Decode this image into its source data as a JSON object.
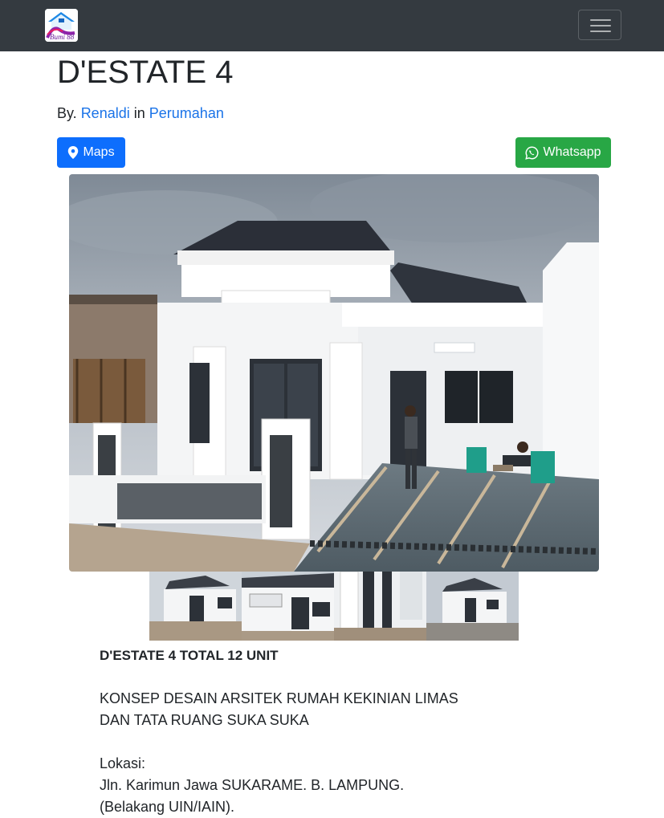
{
  "navbar": {
    "logo_text": "Bumi 88",
    "menu_icon": "hamburger-menu-icon"
  },
  "post": {
    "title": "D'ESTATE 4",
    "byline_prefix": "By.",
    "author": "Renaldi",
    "byline_in": "in",
    "category": "Perumahan"
  },
  "actions": {
    "maps_label": "Maps",
    "maps_icon": "map-marker-icon",
    "whatsapp_label": "Whatsapp",
    "whatsapp_icon": "whatsapp-icon"
  },
  "gallery": {
    "main_image": "house-photo",
    "thumbnails": [
      "thumb-1",
      "thumb-2",
      "thumb-3",
      "thumb-4"
    ]
  },
  "description": {
    "heading": "D'ESTATE 4 TOTAL 12 UNIT",
    "concept_line1": "KONSEP DESAIN ARSITEK RUMAH KEKINIAN LIMAS",
    "concept_line2": "DAN TATA RUANG SUKA SUKA",
    "location_label": "Lokasi:",
    "location_line1": "Jln. Karimun Jawa SUKARAME. B. LAMPUNG.",
    "location_line2": "(Belakang UIN/IAIN)."
  },
  "colors": {
    "navbar": "#343a40",
    "link": "#1a73e8",
    "maps_button": "#0d6efd",
    "whatsapp_button": "#28a745"
  }
}
